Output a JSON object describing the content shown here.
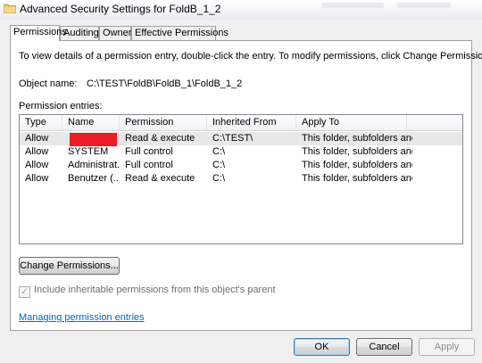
{
  "window": {
    "title": "Advanced Security Settings for FoldB_1_2"
  },
  "tabs": [
    {
      "label": "Permissions"
    },
    {
      "label": "Auditing"
    },
    {
      "label": "Owner"
    },
    {
      "label": "Effective Permissions"
    }
  ],
  "permissions": {
    "info_text": "To view details of a permission entry, double-click the entry. To modify permissions, click Change Permissions.",
    "object_name_label": "Object name:",
    "object_name_value": "C:\\TEST\\FoldB\\FoldB_1\\FoldB_1_2",
    "entries_label": "Permission entries:",
    "columns": [
      "Type",
      "Name",
      "Permission",
      "Inherited From",
      "Apply To"
    ],
    "rows": [
      {
        "type": "Allow",
        "name": "",
        "permission": "Read & execute",
        "inherited_from": "C:\\TEST\\",
        "apply_to": "This folder, subfolders and..."
      },
      {
        "type": "Allow",
        "name": "SYSTEM",
        "permission": "Full control",
        "inherited_from": "C:\\",
        "apply_to": "This folder, subfolders and..."
      },
      {
        "type": "Allow",
        "name": "Administrat...",
        "permission": "Full control",
        "inherited_from": "C:\\",
        "apply_to": "This folder, subfolders and..."
      },
      {
        "type": "Allow",
        "name": "Benutzer (...",
        "permission": "Read & execute",
        "inherited_from": "C:\\",
        "apply_to": "This folder, subfolders and..."
      }
    ],
    "change_button": "Change Permissions...",
    "inherit_checkbox": "Include inheritable permissions from this object's parent",
    "manage_link": "Managing permission entries"
  },
  "footer": {
    "ok": "OK",
    "cancel": "Cancel",
    "apply": "Apply"
  },
  "colors": {
    "link": "#0066cc",
    "redaction": "#ed1c24"
  }
}
